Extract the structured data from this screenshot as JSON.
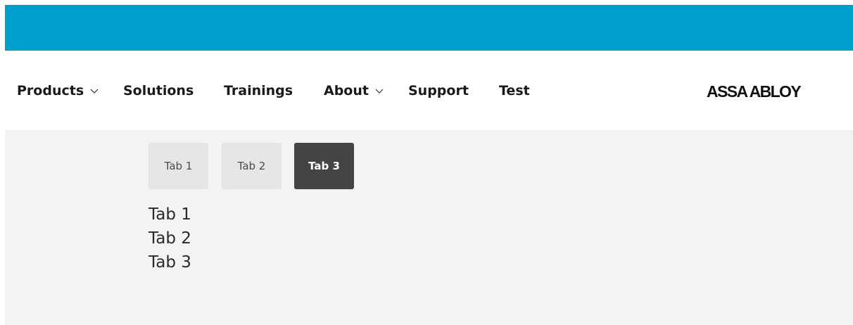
{
  "nav": {
    "items": [
      {
        "label": "Products",
        "has_dropdown": true
      },
      {
        "label": "Solutions",
        "has_dropdown": false
      },
      {
        "label": "Trainings",
        "has_dropdown": false
      },
      {
        "label": "About",
        "has_dropdown": true
      },
      {
        "label": "Support",
        "has_dropdown": false
      },
      {
        "label": "Test",
        "has_dropdown": false
      }
    ]
  },
  "logo": {
    "text": "ASSA ABLOY"
  },
  "tabs": {
    "buttons": [
      {
        "label": "Tab 1",
        "active": false
      },
      {
        "label": "Tab 2",
        "active": false
      },
      {
        "label": "Tab 3",
        "active": true
      }
    ],
    "panels": [
      "Tab 1",
      "Tab 2",
      "Tab 3"
    ]
  },
  "colors": {
    "banner": "#009fd1",
    "content_bg": "#f3f3f3",
    "tab_inactive": "#e6e6e6",
    "tab_active": "#444444"
  }
}
